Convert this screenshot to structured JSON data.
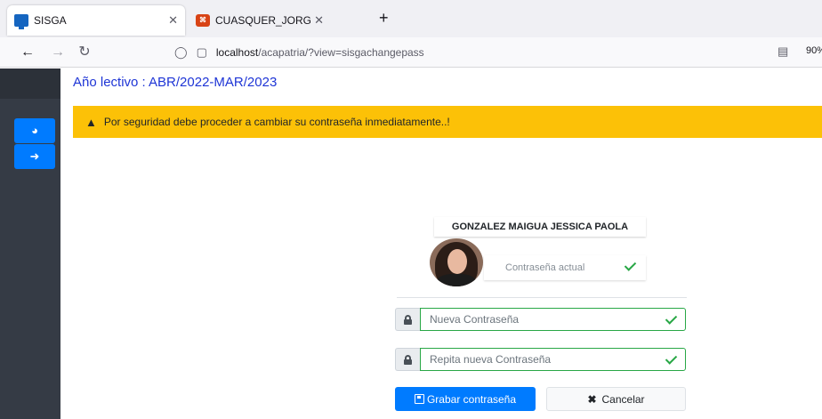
{
  "browser": {
    "tabs": [
      {
        "title": "SISGA",
        "active": true,
        "icon": "monitor-icon"
      },
      {
        "title": "CUASQUER_JORGE_ALBERTO.pd",
        "active": false,
        "icon": "pdf-icon"
      }
    ],
    "new_tab_glyph": "+",
    "url_host": "localhost",
    "url_path": "/acapatria/?view=sisgachangepass",
    "zoom": "90%"
  },
  "page": {
    "title": "Año lectivo : ABR/2022-MAR/2023",
    "alert": "Por seguridad debe proceder a cambiar su contraseña inmediatamente..!"
  },
  "sidebar": {
    "buttons": [
      {
        "icon": "dashboard-icon"
      },
      {
        "icon": "arrow-right-circle-icon"
      }
    ]
  },
  "form": {
    "user_name": "GONZALEZ MAIGUA JESSICA PAOLA",
    "current_password_placeholder": "Contraseña actual",
    "new_password_placeholder": "Nueva Contraseña",
    "repeat_password_placeholder": "Repita nueva Contraseña",
    "save_label": "Grabar contraseña",
    "cancel_label": "Cancelar"
  },
  "colors": {
    "primary": "#007bff",
    "warning": "#fcc107",
    "success": "#28a745",
    "sidebar": "#353b45",
    "title": "#1e35d6"
  }
}
